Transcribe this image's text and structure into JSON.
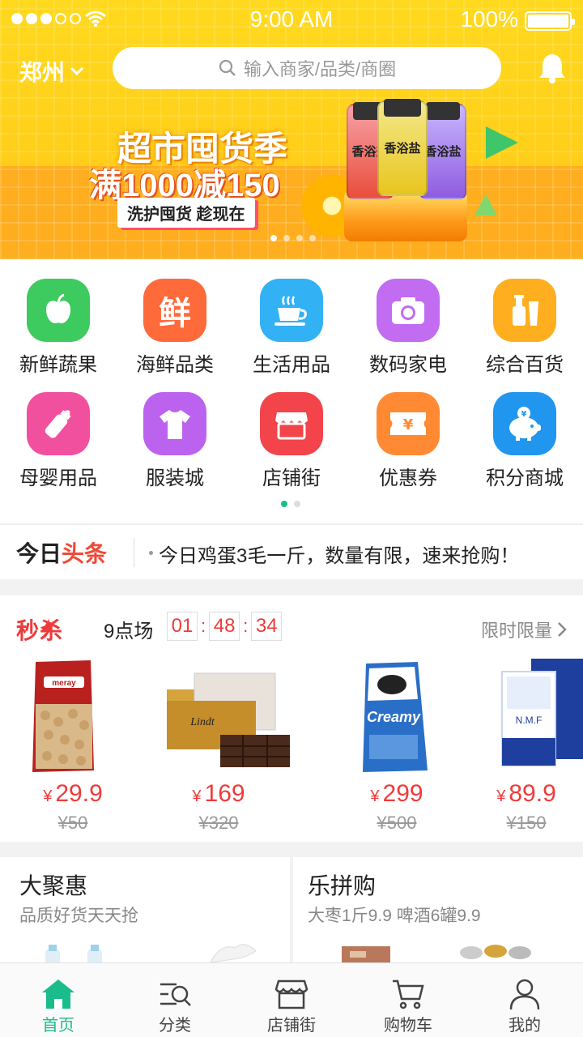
{
  "status_bar": {
    "time": "9:00 AM",
    "battery": "100%"
  },
  "header": {
    "city": "郑州",
    "search_placeholder": "输入商家/品类/商圈"
  },
  "banner": {
    "title": "超市囤货季",
    "subtitle": "满1000减150",
    "tag": "洗护囤货 趁现在",
    "product_label": "香浴盐",
    "page_count": 4,
    "active_page": 1
  },
  "categories": [
    {
      "label": "新鲜蔬果",
      "icon": "apple-icon",
      "color": "#3dcb5f"
    },
    {
      "label": "海鲜品类",
      "icon": "fresh-char-icon",
      "color": "#ff6a3b"
    },
    {
      "label": "生活用品",
      "icon": "coffee-cup-icon",
      "color": "#33b1f5"
    },
    {
      "label": "数码家电",
      "icon": "camera-icon",
      "color": "#c26cf2"
    },
    {
      "label": "综合百货",
      "icon": "bottles-icon",
      "color": "#ffae1f"
    },
    {
      "label": "母婴用品",
      "icon": "baby-bottle-icon",
      "color": "#f1509f"
    },
    {
      "label": "服装城",
      "icon": "tshirt-icon",
      "color": "#bb63ee"
    },
    {
      "label": "店铺街",
      "icon": "store-icon",
      "color": "#f2444a"
    },
    {
      "label": "优惠券",
      "icon": "coupon-icon",
      "color": "#ff8a33"
    },
    {
      "label": "积分商城",
      "icon": "piggy-bank-icon",
      "color": "#2196ef"
    }
  ],
  "headline": {
    "logo_a": "今日",
    "logo_b": "头条",
    "text": "今日鸡蛋3毛一斤，数量有限，速来抢购！"
  },
  "seckill": {
    "title": "秒杀",
    "session": "9点场",
    "hours": "01",
    "minutes": "48",
    "seconds": "34",
    "more": "限时限量",
    "currency": "¥",
    "products": [
      {
        "price": "29.9",
        "old_price": "¥50"
      },
      {
        "price": "169",
        "old_price": "¥320"
      },
      {
        "price": "299",
        "old_price": "¥500"
      },
      {
        "price": "89.9",
        "old_price": "¥150"
      }
    ]
  },
  "promos": [
    {
      "title": "大聚惠",
      "subtitle": "品质好货天天抢"
    },
    {
      "title": "乐拼购",
      "subtitle": "大枣1斤9.9 啤酒6罐9.9"
    }
  ],
  "tabs": [
    {
      "label": "首页",
      "icon": "home-icon",
      "active": true
    },
    {
      "label": "分类",
      "icon": "category-search-icon"
    },
    {
      "label": "店铺街",
      "icon": "store-icon"
    },
    {
      "label": "购物车",
      "icon": "cart-icon"
    },
    {
      "label": "我的",
      "icon": "user-icon"
    }
  ],
  "colors": {
    "accent": "#1abc8c",
    "price": "#ef3b3b",
    "banner": "#ffd21c"
  }
}
